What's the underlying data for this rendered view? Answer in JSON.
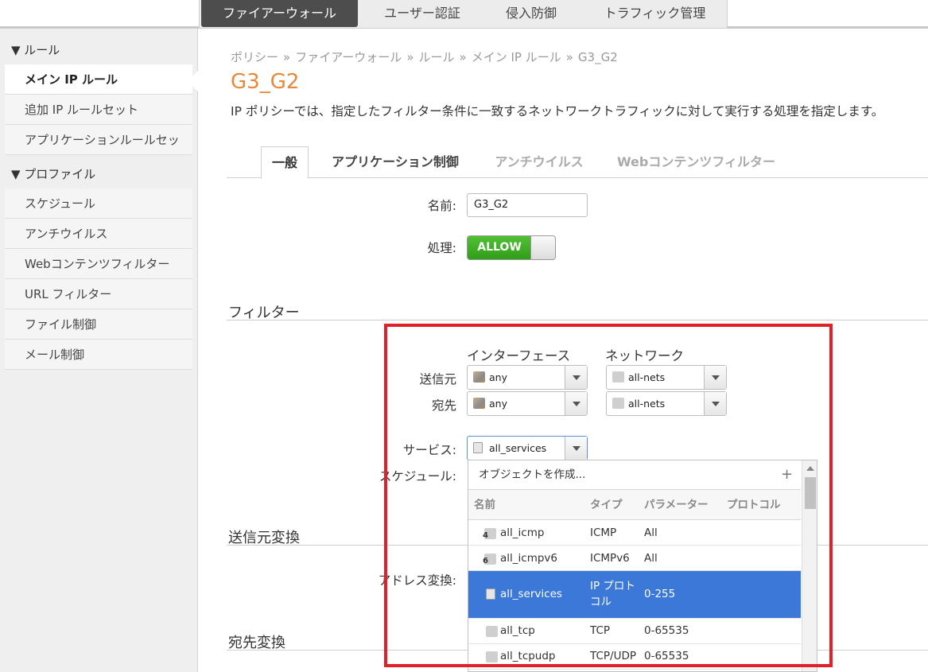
{
  "top_nav": {
    "items": [
      "ファイアーウォール",
      "ユーザー認証",
      "侵入防御",
      "トラフィック管理"
    ],
    "active_index": 0
  },
  "sidebar": {
    "groups": [
      {
        "label": "▼ ルール",
        "items": [
          "メイン IP ルール",
          "追加 IP ルールセット",
          "アプリケーションルールセッ"
        ]
      },
      {
        "label": "▼ プロファイル",
        "items": [
          "スケジュール",
          "アンチウイルス",
          "Webコンテンツフィルター",
          "URL フィルター",
          "ファイル制御",
          "メール制御"
        ]
      }
    ],
    "active_item": "メイン IP ルール"
  },
  "breadcrumb": [
    "ポリシー",
    "ファイアーウォール",
    "ルール",
    "メイン IP ルール",
    "G3_G2"
  ],
  "breadcrumb_sep": "»",
  "page": {
    "title": "G3_G2",
    "description": "IP ポリシーでは、指定したフィルター条件に一致するネットワークトラフィックに対して実行する処理を指定します。"
  },
  "tabs": [
    "一般",
    "アプリケーション制御",
    "アンチウイルス",
    "Webコンテンツフィルター"
  ],
  "general": {
    "name_label": "名前:",
    "name_value": "G3_G2",
    "action_label": "処理:",
    "action_value": "ALLOW"
  },
  "filter": {
    "section_title": "フィルター",
    "col_interface": "インターフェース",
    "col_network": "ネットワーク",
    "source_label": "送信元",
    "dest_label": "宛先",
    "source_interface": "any",
    "source_network": "all-nets",
    "dest_interface": "any",
    "dest_network": "all-nets",
    "service_label": "サービス:",
    "service_value": "all_services",
    "schedule_label": "スケジュール:"
  },
  "source_translation": {
    "section_title": "送信元変換",
    "address_label": "アドレス変換:"
  },
  "dest_translation": {
    "section_title": "宛先変換"
  },
  "dropdown": {
    "create_label": "オブジェクトを作成...",
    "create_icon": "plus",
    "columns": [
      "名前",
      "タイプ",
      "パラメーター",
      "プロトコル"
    ],
    "rows": [
      {
        "name": "all_icmp",
        "type": "ICMP",
        "param": "All",
        "protocol": "",
        "badge": "4"
      },
      {
        "name": "all_icmpv6",
        "type": "ICMPv6",
        "param": "All",
        "protocol": "",
        "badge": "6"
      },
      {
        "name": "all_services",
        "type": "IP プロト\nコル",
        "param": "0-255",
        "protocol": "",
        "badge": ""
      },
      {
        "name": "all_tcp",
        "type": "TCP",
        "param": "0-65535",
        "protocol": "",
        "badge": ""
      },
      {
        "name": "all_tcpudp",
        "type": "TCP/UDP",
        "param": "0-65535",
        "protocol": "",
        "badge": ""
      }
    ],
    "selected_index": 2
  },
  "colors": {
    "accent_title": "#e8883a",
    "toggle_green": "#3fae22",
    "selection_blue": "#3b78d8",
    "highlight_red": "#e2202a"
  }
}
